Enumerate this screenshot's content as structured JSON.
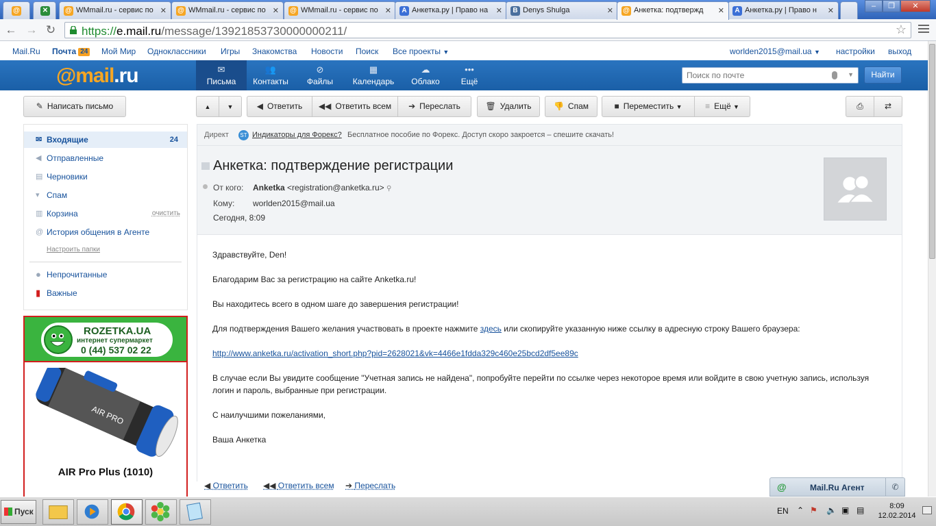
{
  "browser": {
    "tabs": [
      {
        "label": "",
        "icon": "mailru-icon"
      },
      {
        "label": "",
        "icon": "x-icon"
      },
      {
        "label": "WMmail.ru - сервис по",
        "icon": "mailru-icon"
      },
      {
        "label": "WMmail.ru - сервис по",
        "icon": "mailru-icon"
      },
      {
        "label": "WMmail.ru - сервис по",
        "icon": "mailru-icon"
      },
      {
        "label": "Анкетка.ру | Право на",
        "icon": "anketka-icon"
      },
      {
        "label": "Denys Shulga",
        "icon": "vk-icon"
      },
      {
        "label": "Анкетка: подтвержд",
        "icon": "mailru-icon"
      },
      {
        "label": "Анкетка.ру | Право н",
        "icon": "anketka-icon"
      }
    ],
    "url_scheme": "https://",
    "url_host": "e.mail.ru",
    "url_path": "/message/13921853730000000211/"
  },
  "portal": {
    "mailru": "Mail.Ru",
    "pochta": "Почта",
    "pochta_count": "24",
    "moi_mir": "Мой Мир",
    "ok": "Одноклассники",
    "games": "Игры",
    "dating": "Знакомства",
    "news": "Новости",
    "search": "Поиск",
    "all_projects": "Все проекты",
    "user": "worlden2015@mail.ua",
    "settings": "настройки",
    "logout": "выход"
  },
  "header": {
    "logo_at": "@mail",
    "logo_ru": ".ru",
    "nav": [
      "Письма",
      "Контакты",
      "Файлы",
      "Календарь",
      "Облако",
      "Ещё"
    ],
    "search_placeholder": "Поиск по почте",
    "find": "Найти"
  },
  "toolbar": {
    "compose": "Написать письмо",
    "reply": "Ответить",
    "reply_all": "Ответить всем",
    "forward": "Переслать",
    "delete": "Удалить",
    "spam": "Спам",
    "move": "Переместить",
    "more": "Ещё"
  },
  "folders": {
    "items": [
      {
        "label": "Входящие",
        "count": "24"
      },
      {
        "label": "Отправленные"
      },
      {
        "label": "Черновики"
      },
      {
        "label": "Спам"
      },
      {
        "label": "Корзина",
        "action": "очистить"
      },
      {
        "label": "История общения в Агенте"
      }
    ],
    "setup": "Настроить папки",
    "unread": "Непрочитанные",
    "important": "Важные"
  },
  "ad": {
    "brand": "ROZETKA.UA",
    "subtitle": "интернет супермаркет",
    "phone": "0 (44) 537 02 22",
    "product": "AIR Pro Plus (1010)"
  },
  "direct": {
    "label": "Директ",
    "link": "Индикаторы для Форекс?",
    "text": "Бесплатное пособие по Форекс. Доступ скоро закроется – спешите скачать!"
  },
  "message": {
    "subject": "Анкетка: подтверждение регистрации",
    "from_label": "От кого:",
    "from_name": "Anketka",
    "from_email": "<registration@anketka.ru>",
    "to_label": "Кому:",
    "to": "worlden2015@mail.ua",
    "date": "Сегодня, 8:09",
    "body": {
      "greeting": "Здравствуйте, Den!",
      "thanks": "Благодарим Вас за регистрацию на сайте Anketka.ru!",
      "step": "Вы находитесь всего в одном шаге до завершения регистрации!",
      "confirm_before": "Для подтверждения Вашего желания участвовать в проекте нажмите ",
      "confirm_link": "здесь",
      "confirm_after": " или скопируйте указанную ниже ссылку в адресную строку Вашего браузера:",
      "activation_url": "http://www.anketka.ru/activation_short.php?pid=2628021&vk=4466e1fdda329c460e25bcd2df5ee89c",
      "notfound": "В случае если Вы увидите сообщение \"Учетная запись не найдена\", попробуйте перейти по ссылке через некоторое время или войдите в свою учетную запись, используя логин и пароль, выбранные при регистрации.",
      "regards": "С наилучшими пожеланиями,",
      "signature": "Ваша Анкетка"
    },
    "bottom_reply": "Ответить",
    "bottom_reply_all": "Ответить всем",
    "bottom_forward": "Переслать"
  },
  "agent": {
    "label": "Mail.Ru Агент"
  },
  "taskbar": {
    "start": "Пуск",
    "lang": "EN",
    "time": "8:09",
    "date": "12.02.2014"
  }
}
